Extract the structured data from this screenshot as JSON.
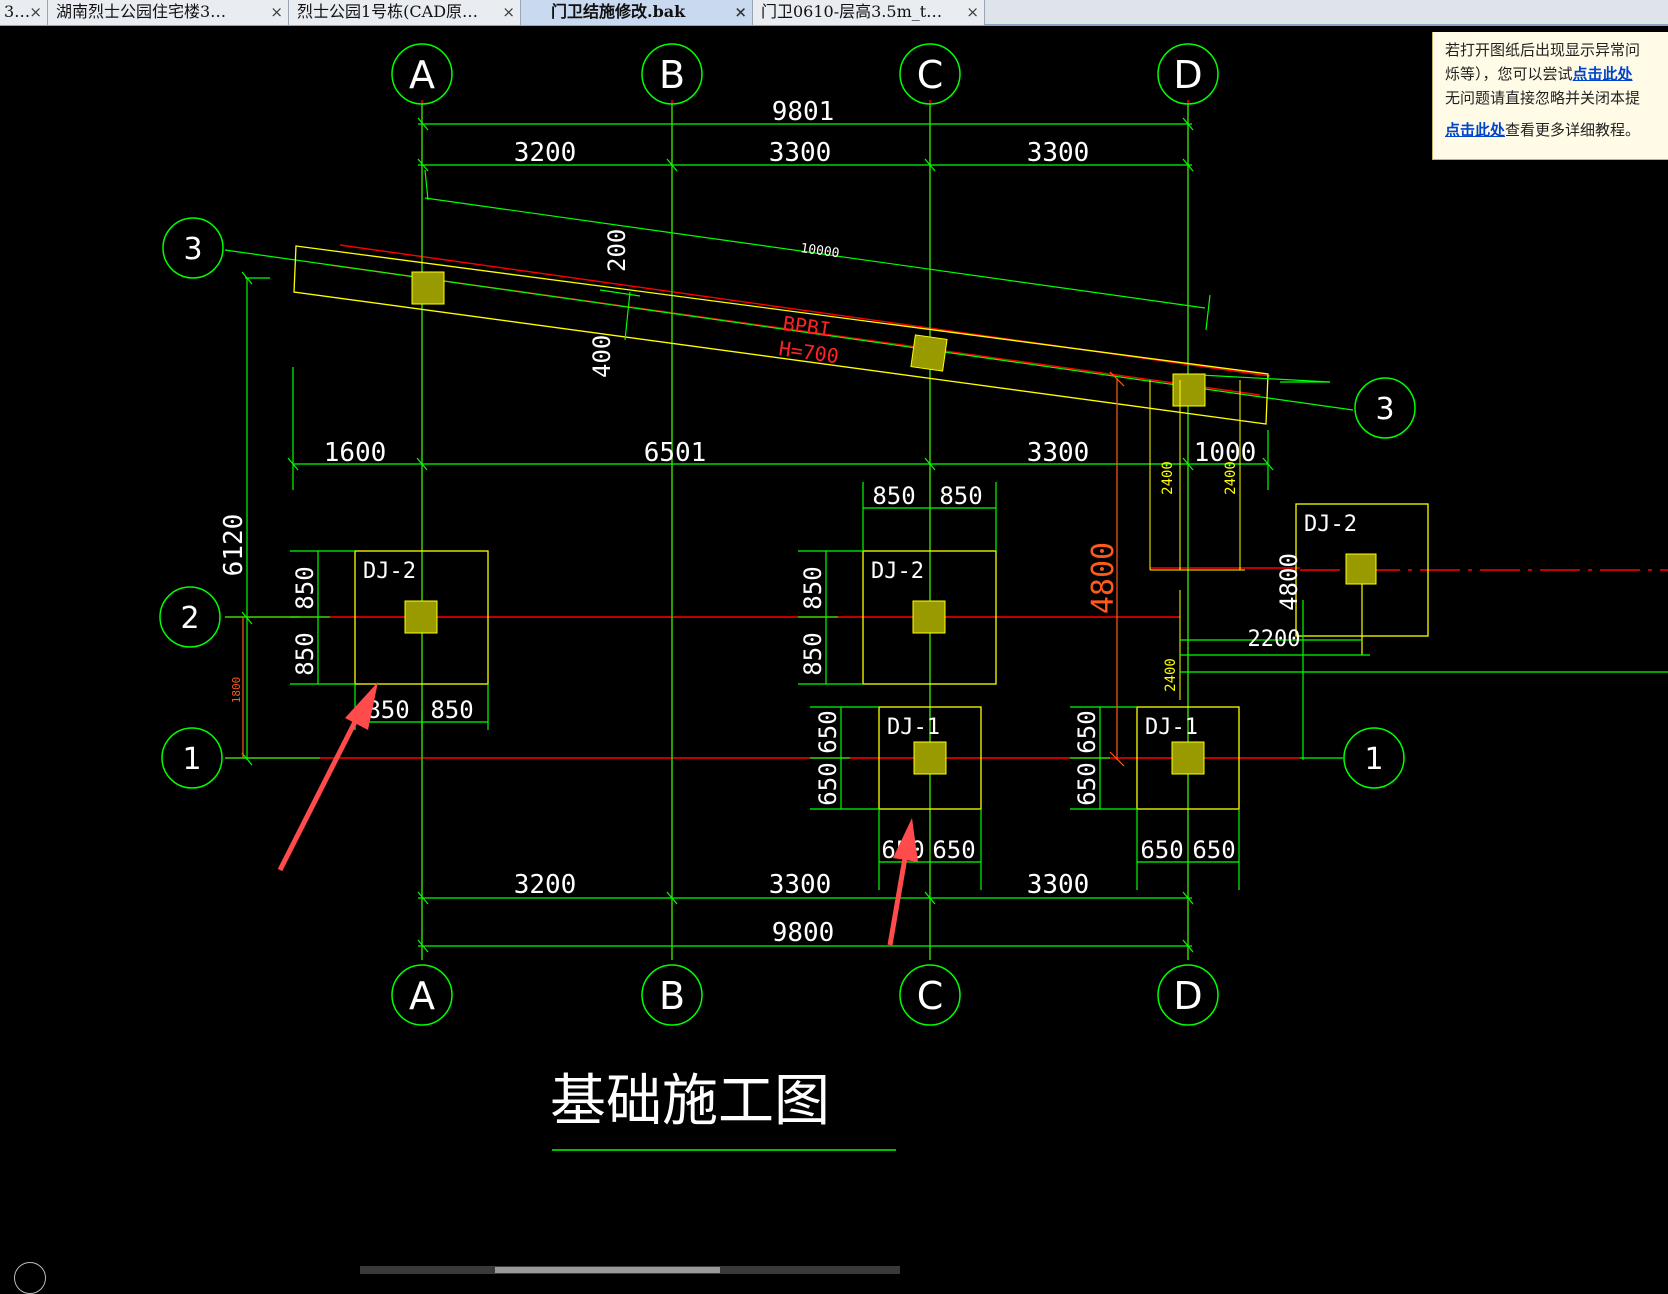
{
  "tabs": [
    {
      "label": "3…",
      "close": "×"
    },
    {
      "label": "湖南烈士公园住宅楼3…",
      "close": "×"
    },
    {
      "label": "烈士公园1号栋(CAD原…",
      "close": "×"
    },
    {
      "label": "门卫结施修改.bak",
      "close": "×",
      "active": true
    },
    {
      "label": "门卫0610-层高3.5m_t…",
      "close": "×"
    }
  ],
  "notice": {
    "line1": "若打开图纸后出现显示异常问",
    "line2_a": "烁等），您可以尝试",
    "line2_link": "点击此处",
    "line3": "无问题请直接忽略并关闭本提",
    "line4_link": "点击此处",
    "line4_b": "查看更多详细教程。"
  },
  "drawing": {
    "title": "基础施工图",
    "axes_top": [
      "A",
      "B",
      "C",
      "D"
    ],
    "axes_bottom": [
      "A",
      "B",
      "C",
      "D"
    ],
    "axes_left": [
      "3",
      "2",
      "1"
    ],
    "axes_right": [
      "3",
      "1"
    ],
    "dims_top_total": "9801",
    "dims_top": [
      "3200",
      "3300",
      "3300"
    ],
    "dims_mid": [
      "1600",
      "6501",
      "3300",
      "1000"
    ],
    "dims_bottom": [
      "3200",
      "3300",
      "3300"
    ],
    "dims_bottom_total": "9800",
    "dim_left_total": "6120",
    "dim_left_small": "1800",
    "beam_length": "10000",
    "beam_w1": "200",
    "beam_w2": "400",
    "beam_label": "BPBI",
    "beam_height": "H=700",
    "dim_4800_red": "4800",
    "dim_4800": "4800",
    "dim_2200": "2200",
    "dim_2400": "2400",
    "footings": [
      {
        "label": "DJ-2",
        "d1": "850",
        "d2": "850",
        "b1": "850",
        "b2": "850"
      },
      {
        "label": "DJ-2",
        "d1": "850",
        "d2": "850",
        "t1": "850",
        "t2": "850"
      },
      {
        "label": "DJ-2"
      },
      {
        "label": "DJ-1",
        "d1": "650",
        "d2": "650",
        "b1": "650",
        "b2": "650"
      },
      {
        "label": "DJ-1",
        "d1": "650",
        "d2": "650",
        "b1": "650",
        "b2": "650"
      }
    ]
  },
  "colors": {
    "grid": "#ff0000",
    "dimension": "#00ff00",
    "footing": "#ffff00",
    "column": "#999900",
    "arrow": "#ff4b4b",
    "text": "#ffffff"
  }
}
